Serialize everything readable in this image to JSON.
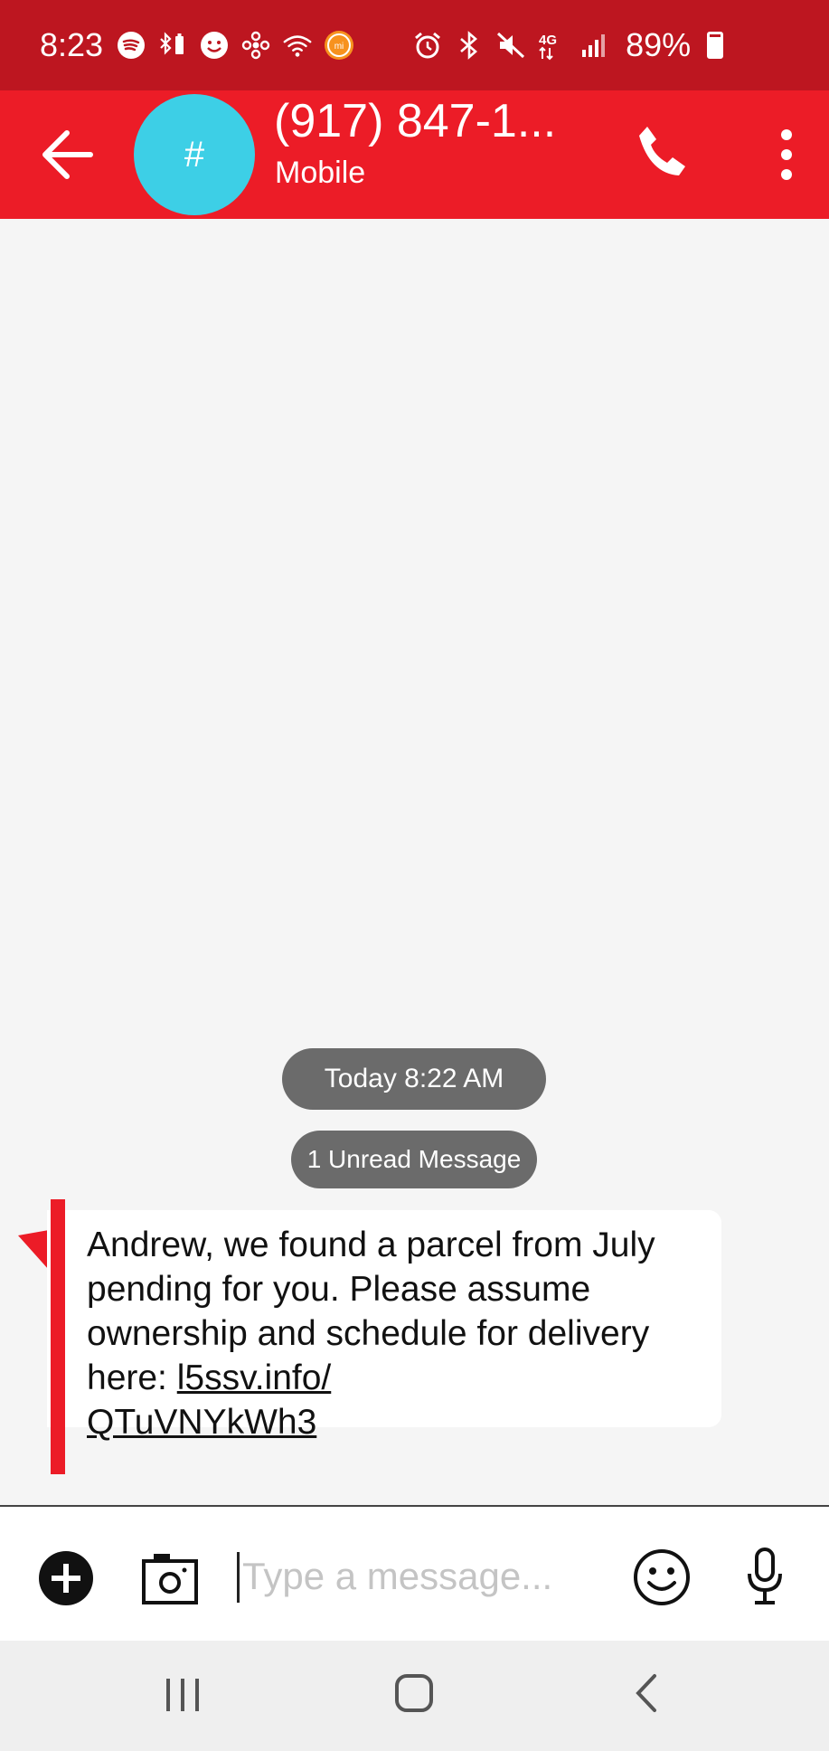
{
  "status_bar": {
    "time": "8:23",
    "battery_percent": "89%",
    "network": "4G",
    "icons": [
      "spotify-icon",
      "bluetooth-battery-icon",
      "smiley-notification-icon",
      "network-flower-icon",
      "wifi-icon",
      "mi-icon",
      "alarm-icon",
      "bluetooth-icon",
      "mute-icon",
      "lte-icon",
      "signal-icon",
      "battery-icon"
    ]
  },
  "app_bar": {
    "title": "(917) 847-1...",
    "subtitle": "Mobile",
    "avatar_glyph": "#",
    "avatar_color": "#3dcfe6",
    "bar_color": "#ec1c27"
  },
  "conversation": {
    "date_pill": "Today 8:22 AM",
    "unread_pill": "1 Unread Message",
    "message": {
      "text": "Andrew, we found a parcel from July pending for you. Please assume ownership and schedule for delivery here: ",
      "link": "l5ssv.info/QTuVNYkWh3",
      "link_display_1": "l5ssv.info/",
      "link_display_2": "QTuVNYkWh3"
    }
  },
  "composer": {
    "placeholder": "Type a message...",
    "value": ""
  },
  "nav_bar": {
    "buttons": [
      "recent-apps",
      "home",
      "back"
    ]
  }
}
